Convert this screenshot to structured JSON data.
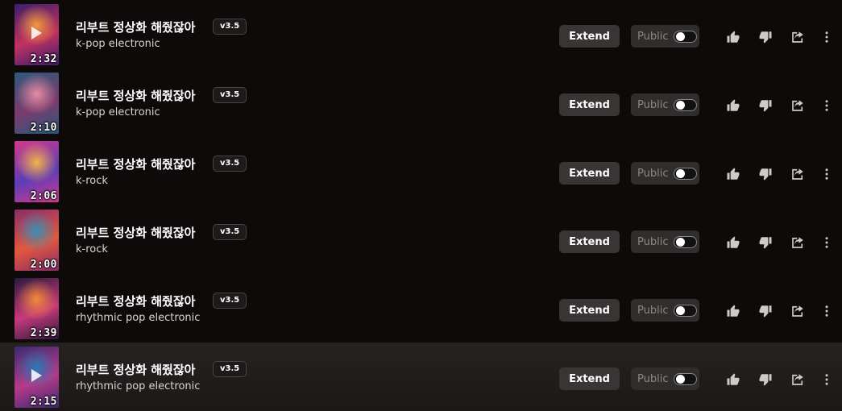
{
  "songs": [
    {
      "title": "리부트 정상화 해줬잖아",
      "version": "v3.5",
      "genre": "k-pop electronic",
      "duration": "2:32",
      "art": [
        "#3b1d6e",
        "#c2325f",
        "#f09a3e"
      ]
    },
    {
      "title": "리부트 정상화 해줬잖아",
      "version": "v3.5",
      "genre": "k-pop electronic",
      "duration": "2:10",
      "art": [
        "#2a5a7a",
        "#7a3b6e",
        "#e78aa3"
      ]
    },
    {
      "title": "리부트 정상화 해줬잖아",
      "version": "v3.5",
      "genre": "k-rock",
      "duration": "2:06",
      "art": [
        "#d43a8a",
        "#5b3db8",
        "#f2b24a"
      ]
    },
    {
      "title": "리부트 정상화 해줬잖아",
      "version": "v3.5",
      "genre": "k-rock",
      "duration": "2:00",
      "art": [
        "#8a2b6b",
        "#e4593b",
        "#3a8fb5"
      ]
    },
    {
      "title": "리부트 정상화 해줬잖아",
      "version": "v3.5",
      "genre": "rhythmic pop electronic",
      "duration": "2:39",
      "art": [
        "#2a1a3e",
        "#c73a7a",
        "#f28a3a"
      ]
    },
    {
      "title": "리부트 정상화 해줬잖아",
      "version": "v3.5",
      "genre": "rhythmic pop electronic",
      "duration": "2:15",
      "art": [
        "#3a2a6e",
        "#b83a8a",
        "#2a7ab5"
      ]
    }
  ],
  "actions": {
    "extend_label": "Extend",
    "public_label": "Public"
  },
  "colors": {
    "background": "#0f0a0a",
    "highlight_row": "#262222",
    "button": "#3a3535"
  },
  "icons": [
    "thumbs-up-icon",
    "thumbs-down-icon",
    "share-icon",
    "more-vertical-icon",
    "play-icon"
  ]
}
